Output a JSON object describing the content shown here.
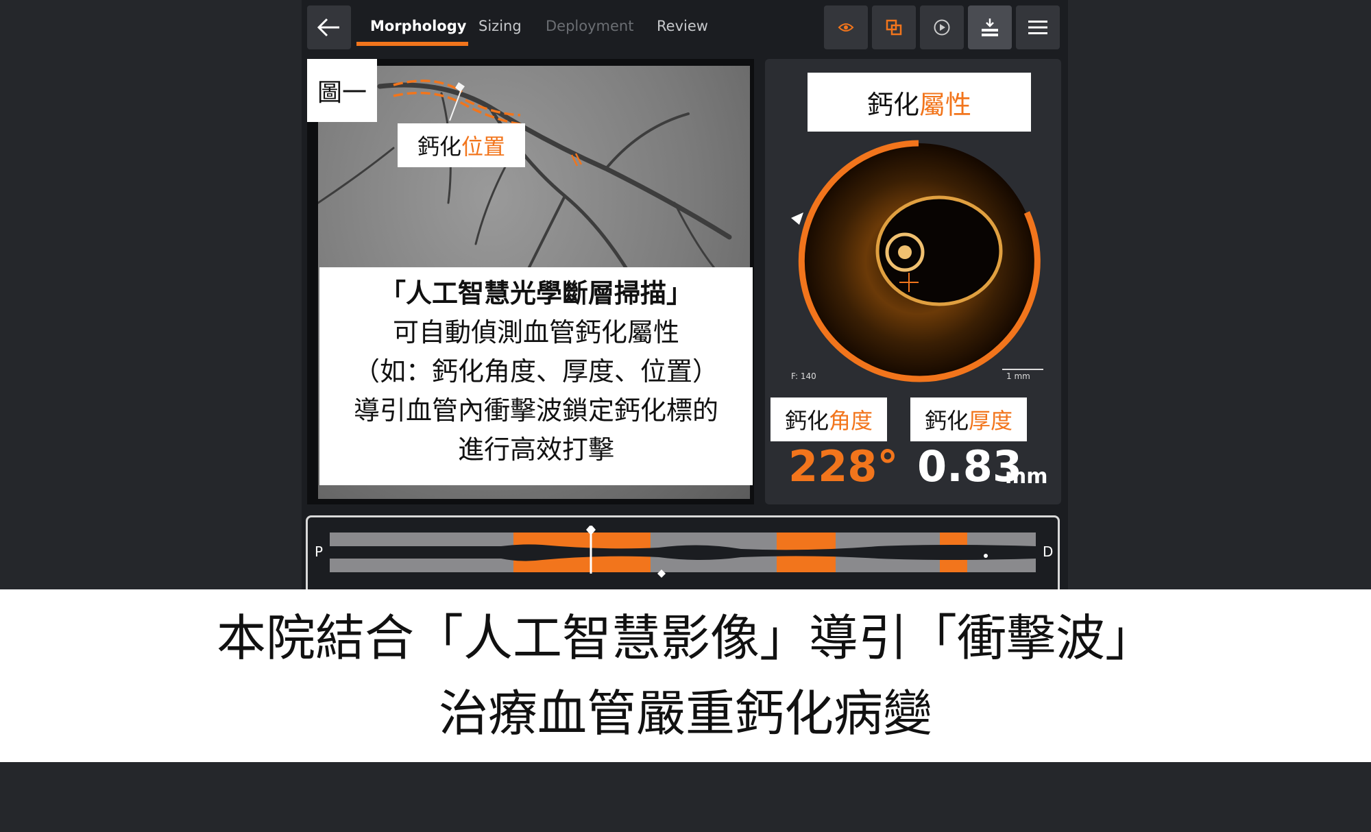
{
  "header": {
    "tabs": [
      {
        "label": "Morphology",
        "state": "active"
      },
      {
        "label": "Sizing",
        "state": "normal"
      },
      {
        "label": "Deployment",
        "state": "disabled"
      },
      {
        "label": "Review",
        "state": "normal"
      }
    ],
    "tools": [
      "eye-icon",
      "overlay-icon",
      "play-icon",
      "download-icon",
      "menu-icon"
    ]
  },
  "angio": {
    "figure_label": "圖一",
    "location_label_black": "鈣化",
    "location_label_orange": "位置",
    "info_title": "「人工智慧光學斷層掃描」",
    "info_lines": [
      "可自動偵測血管鈣化屬性",
      "（如：鈣化角度、厚度、位置）",
      "導引血管內衝擊波鎖定鈣化標的",
      "進行高效打擊"
    ]
  },
  "oct": {
    "title_black": "鈣化",
    "title_orange": "屬性",
    "frame_label": "F: 140",
    "scale_label": "1 mm",
    "angle_label_black": "鈣化",
    "angle_label_orange": "角度",
    "angle_value": "228°",
    "thickness_label_black": "鈣化",
    "thickness_label_orange": "厚度",
    "thickness_value": "0.83",
    "thickness_unit": "mm"
  },
  "longitudinal": {
    "proximal_label": "P",
    "distal_label": "D"
  },
  "caption": {
    "line1": "本院結合「人工智慧影像」導引「衝擊波」",
    "line2": "治療血管嚴重鈣化病變"
  },
  "colors": {
    "accent": "#f2751c",
    "background": "#25272b",
    "panel": "#2b2d32"
  }
}
